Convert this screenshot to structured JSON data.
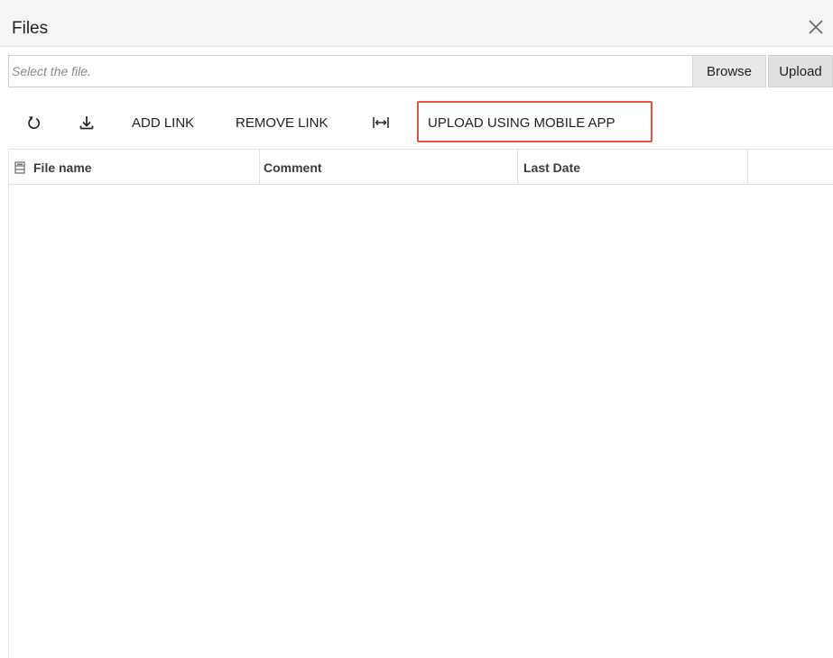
{
  "dialog": {
    "title": "Files"
  },
  "file_select": {
    "placeholder": "Select the file.",
    "value": "",
    "browse_label": "Browse",
    "upload_label": "Upload"
  },
  "toolbar": {
    "refresh_icon": "refresh-icon",
    "download_icon": "download-icon",
    "add_link_label": "ADD LINK",
    "remove_link_label": "REMOVE LINK",
    "fit_columns_icon": "fit-columns-icon",
    "upload_mobile_label": "UPLOAD USING MOBILE APP",
    "highlight_color": "#e5533a"
  },
  "grid": {
    "columns": [
      {
        "label": "File name"
      },
      {
        "label": "Comment"
      },
      {
        "label": "Last Date"
      },
      {
        "label": ""
      }
    ],
    "rows": []
  }
}
